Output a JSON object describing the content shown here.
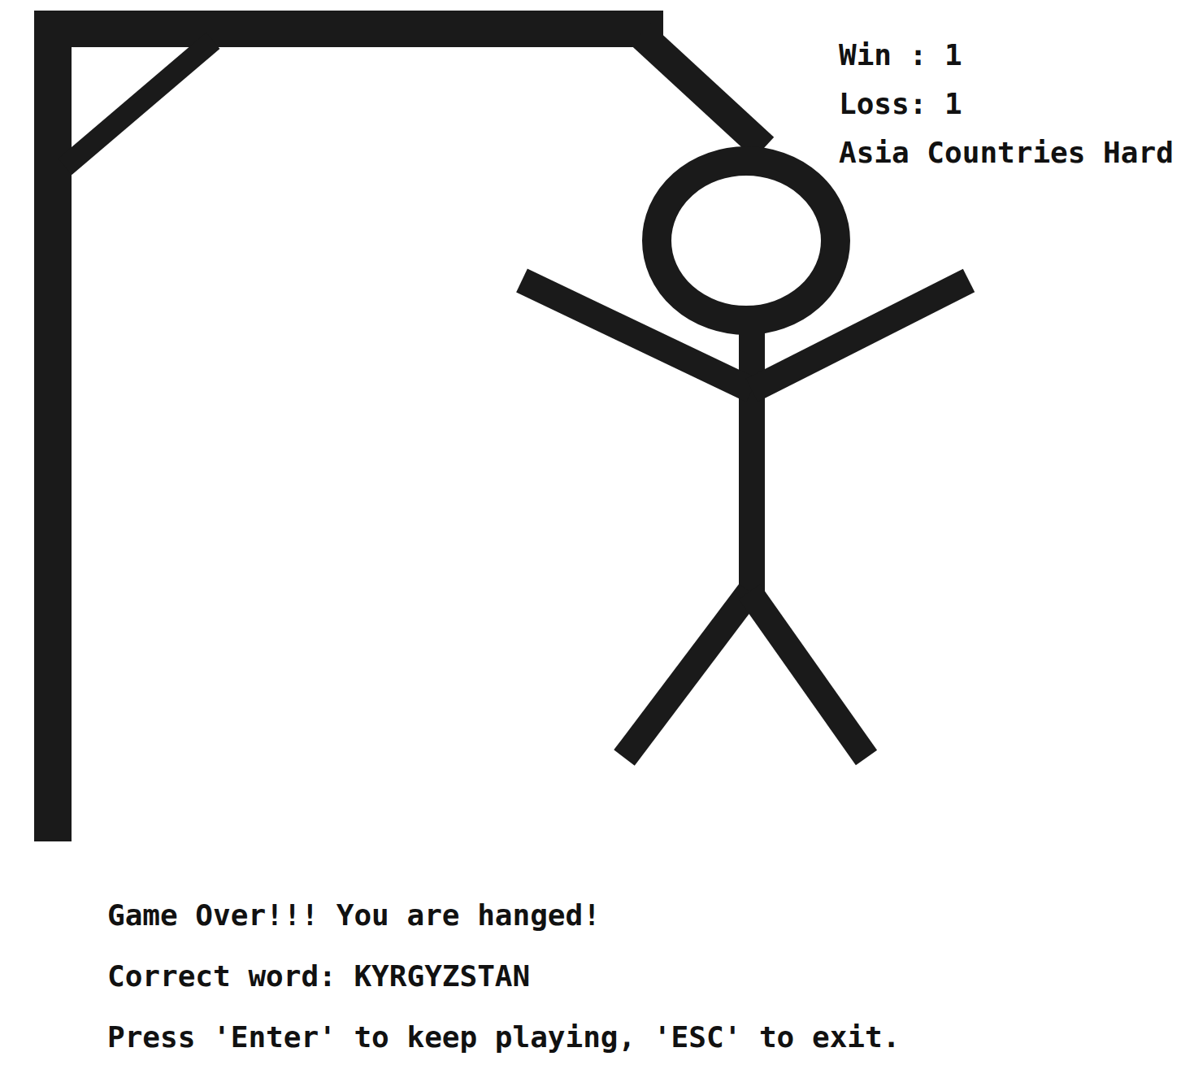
{
  "stats": {
    "win": "Win : 1",
    "loss": "Loss: 1",
    "category": "Asia Countries Hard"
  },
  "hangman": {
    "parts": [
      {
        "kind": "head",
        "drawn": true
      },
      {
        "kind": "body",
        "drawn": true
      },
      {
        "kind": "left-arm",
        "drawn": true
      },
      {
        "kind": "right-arm",
        "drawn": true
      },
      {
        "kind": "left-leg",
        "drawn": true
      },
      {
        "kind": "right-leg",
        "drawn": true
      }
    ]
  },
  "messages": {
    "status": "Game Over!!! You are hanged!",
    "answer": "Correct word: KYRGYZSTAN",
    "prompt": "Press 'Enter' to keep playing, 'ESC' to exit."
  }
}
